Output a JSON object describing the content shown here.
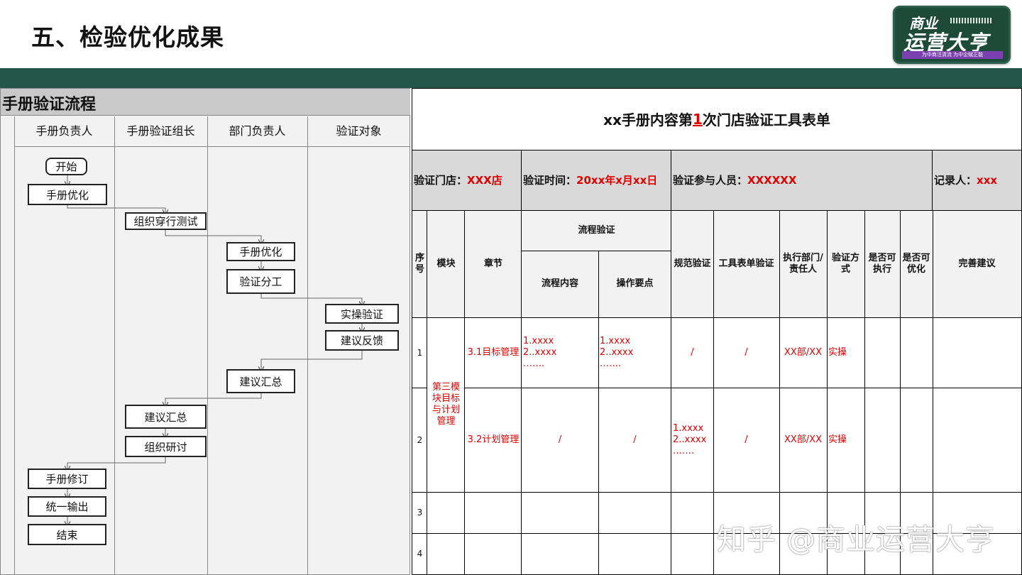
{
  "page": {
    "title": "五、检验优化成果"
  },
  "logo": {
    "line1": "商业",
    "line2": "运营大亨",
    "tagline": "为中商注清流 为中企赋正能"
  },
  "flow": {
    "title": "手册验证流程",
    "lanes": [
      "手册负责人",
      "手册验证组长",
      "部门负责人",
      "验证对象"
    ],
    "steps": {
      "start": "开始",
      "optimize1": "手册优化",
      "walkthrough": "组织穿行测试",
      "optimize2": "手册优化",
      "assign": "验证分工",
      "practice": "实操验证",
      "feedback": "建议反馈",
      "summary1": "建议汇总",
      "summary2": "建议汇总",
      "discuss": "组织研讨",
      "revise": "手册修订",
      "output": "统一输出",
      "end": "结束"
    }
  },
  "form": {
    "title_pre": "xx手册内容第",
    "title_num": "1",
    "title_post": "次门店验证工具表单",
    "info": {
      "store_label": "验证门店：",
      "store_value": "XXX店",
      "time_label": "验证时间：",
      "time_value": "20xx年x月xx日",
      "people_label": "验证参与人员：",
      "people_value": "XXXXXX",
      "recorder_label": "记录人：",
      "recorder_value": "xxx"
    },
    "headers": {
      "seq": "序号",
      "module": "模块",
      "chapter": "章节",
      "process": "流程验证",
      "process_content": "流程内容",
      "key_points": "操作要点",
      "norm": "规范验证",
      "tool_form": "工具表单验证",
      "dept": "执行部门/责任人",
      "method": "验证方式",
      "executable": "是否可执行",
      "optimizable": "是否可优化",
      "suggestion": "完善建议"
    },
    "module_value": "第三模块目标与计划管理",
    "rows": [
      {
        "seq": "1",
        "chapter": "3.1目标管理",
        "content": "1.xxxx\n2..xxxx\n…….",
        "points": "1.xxxx\n2..xxxx\n…….",
        "norm": "/",
        "tool": "/",
        "dept": "XX部/XX",
        "method": "实操"
      },
      {
        "seq": "2",
        "chapter": "3.2计划管理",
        "content": "/",
        "points": "/",
        "norm": "1.xxxx\n2..xxxx\n…….",
        "tool": "/",
        "dept": "XX部/XX",
        "method": "实操"
      },
      {
        "seq": "3"
      },
      {
        "seq": "4"
      }
    ]
  },
  "watermark": "知乎 @商业运营大亨"
}
